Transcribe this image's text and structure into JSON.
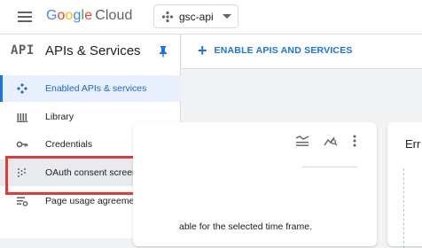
{
  "topbar": {
    "logo_parts": [
      "G",
      "o",
      "o",
      "g",
      "l",
      "e"
    ],
    "logo_product": "Cloud",
    "project": "gsc-api"
  },
  "sidebar": {
    "badge": "API",
    "title": "APIs & Services",
    "items": [
      {
        "label": "Enabled APIs & services",
        "icon": "diamond-dots-icon",
        "active": true
      },
      {
        "label": "Library",
        "icon": "library-icon"
      },
      {
        "label": "Credentials",
        "icon": "key-icon"
      },
      {
        "label": "OAuth consent screen",
        "icon": "consent-icon",
        "highlighted": true
      },
      {
        "label": "Page usage agreements",
        "icon": "settings-list-icon"
      }
    ]
  },
  "actionbar": {
    "enable_label": "ENABLE APIS AND SERVICES"
  },
  "card1": {
    "message": "able for the selected time frame."
  },
  "card2": {
    "title": "Err"
  },
  "colors": {
    "accent": "#1a73e8",
    "callout": "#e53935",
    "active_bg": "#e8f0fe"
  }
}
